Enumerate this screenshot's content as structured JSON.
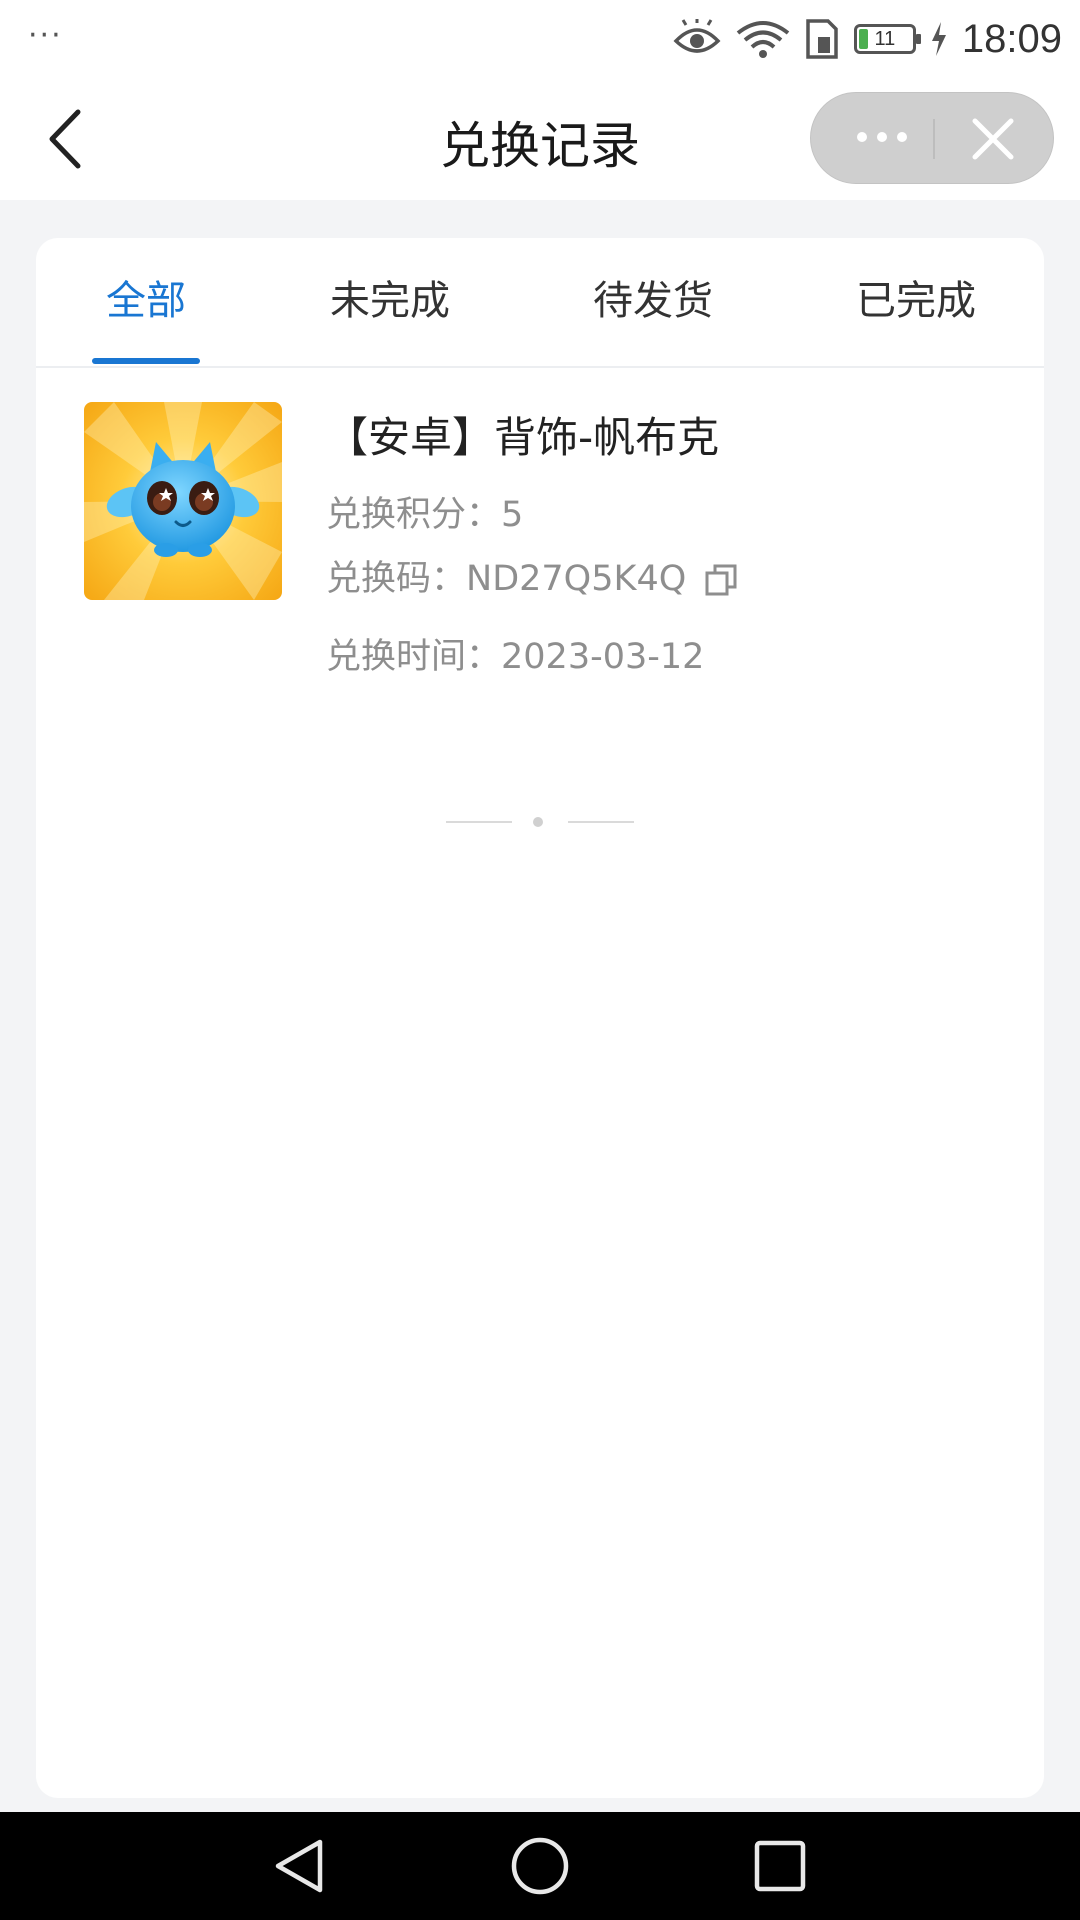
{
  "status_bar": {
    "notification_dots": "···",
    "battery_level": "11",
    "time": "18:09",
    "icons": [
      "eye-icon",
      "wifi-icon",
      "sim-card-icon",
      "battery-icon",
      "charging-icon"
    ]
  },
  "nav": {
    "title": "兑换记录",
    "icons": [
      "back-arrow-icon",
      "more-dots-icon",
      "close-icon"
    ]
  },
  "tabs": [
    {
      "label": "全部",
      "active": true
    },
    {
      "label": "未完成",
      "active": false
    },
    {
      "label": "待发货",
      "active": false
    },
    {
      "label": "已完成",
      "active": false
    }
  ],
  "records": [
    {
      "title": "【安卓】背饰-帆布克",
      "points_label": "兑换积分：",
      "points_value": "5",
      "code_label": "兑换码：",
      "code_value": "ND27Q5K4Q",
      "time_label": "兑换时间：",
      "time_value": "2023-03-12"
    }
  ],
  "colors": {
    "accent": "#1976d2",
    "background": "#f3f4f6",
    "card": "#ffffff",
    "secondary_text": "#8e8e8e",
    "thumb_bg": "#f7b21b",
    "mascot": "#33aaf0"
  }
}
